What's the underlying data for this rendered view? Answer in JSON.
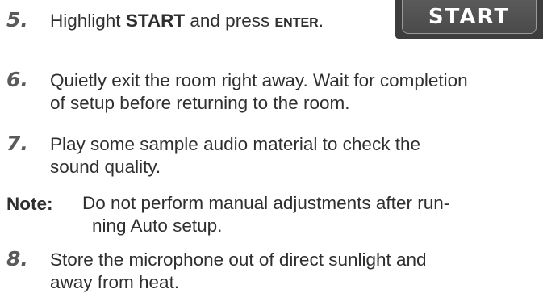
{
  "steps": [
    {
      "number": "5.",
      "text_a": "Highlight ",
      "text_b": "START",
      "text_c": " and press ",
      "text_d": "ENTER",
      "text_e": "."
    },
    {
      "number": "6.",
      "line1": "Quietly exit the room right away.  Wait for completion",
      "line2": "of setup before returning to the room."
    },
    {
      "number": "7.",
      "line1": "Play some sample audio material to check the",
      "line2": "sound quality."
    },
    {
      "number": "8.",
      "line1": "Store the microphone out of direct sunlight and",
      "line2": "away from heat."
    }
  ],
  "start_button": {
    "label": "START"
  },
  "note": {
    "label": "Note:",
    "line1": "Do not perform manual adjustments after run-",
    "line2": "ning Auto setup."
  }
}
